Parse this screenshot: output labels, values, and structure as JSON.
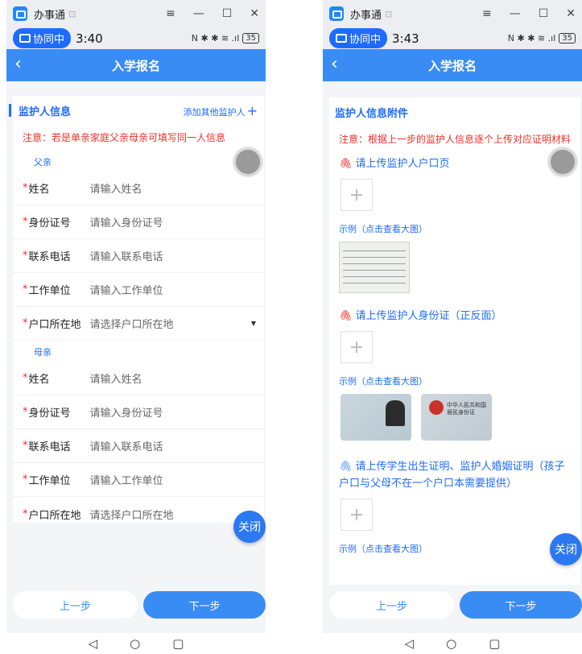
{
  "window": {
    "app_title": "办事通",
    "pin_glyph": "⊡",
    "menu_glyph": "≡",
    "minimize_glyph": "—",
    "maximize_glyph": "☐",
    "close_glyph": "✕"
  },
  "status": {
    "collab_label": "协同中",
    "time_left": "3:40",
    "time_right": "3:43",
    "sys_icons": "N ✱ ✱ ≋ .ıl",
    "battery": "35"
  },
  "nav": {
    "back_glyph": "‹",
    "title": "入学报名"
  },
  "guardian_form": {
    "section_title": "监护人信息",
    "add_guardian": "添加其他监护人",
    "add_plus": "+",
    "notice": "注意：若是单亲家庭父亲母亲可填写同一人信息",
    "required_mark": "*",
    "caret": "▼",
    "father": {
      "label": "父亲",
      "fields": [
        {
          "label": "姓名",
          "placeholder": "请输入姓名"
        },
        {
          "label": "身份证号",
          "placeholder": "请输入身份证号"
        },
        {
          "label": "联系电话",
          "placeholder": "请输入联系电话"
        },
        {
          "label": "工作单位",
          "placeholder": "请输入工作单位"
        },
        {
          "label": "户口所在地",
          "placeholder": "请选择户口所在地"
        }
      ]
    },
    "mother": {
      "label": "母亲",
      "fields": [
        {
          "label": "姓名",
          "placeholder": "请输入姓名"
        },
        {
          "label": "身份证号",
          "placeholder": "请输入身份证号"
        },
        {
          "label": "联系电话",
          "placeholder": "请输入联系电话"
        },
        {
          "label": "工作单位",
          "placeholder": "请输入工作单位"
        },
        {
          "label": "户口所在地",
          "placeholder": "请选择户口所在地"
        }
      ]
    }
  },
  "attachments": {
    "section_title": "监护人信息附件",
    "notice": "注意：根据上一步的监护人信息逐个上传对应证明材料",
    "clip_glyph": "🖇",
    "upload_plus": "+",
    "items": [
      {
        "label": "请上传监护人户口页",
        "example": "示例（点击查看大图）"
      },
      {
        "label": "请上传监护人身份证（正反面）",
        "example": "示例（点击查看大图）"
      },
      {
        "label": "请上传学生出生证明、监护人婚姻证明（孩子户口与父母不在一个户口本需要提供）",
        "example": "示例（点击查看大图）"
      }
    ],
    "id_back_text": "中华人民共和国 居民身份证"
  },
  "buttons": {
    "close": "关闭",
    "prev": "上一步",
    "next": "下一步"
  },
  "sysnav": {
    "back": "◁",
    "home": "○",
    "recent": "▢"
  },
  "colors": {
    "primary": "#3a8cf5",
    "link_blue": "#1e6cff",
    "warning_red": "#e8332a"
  }
}
